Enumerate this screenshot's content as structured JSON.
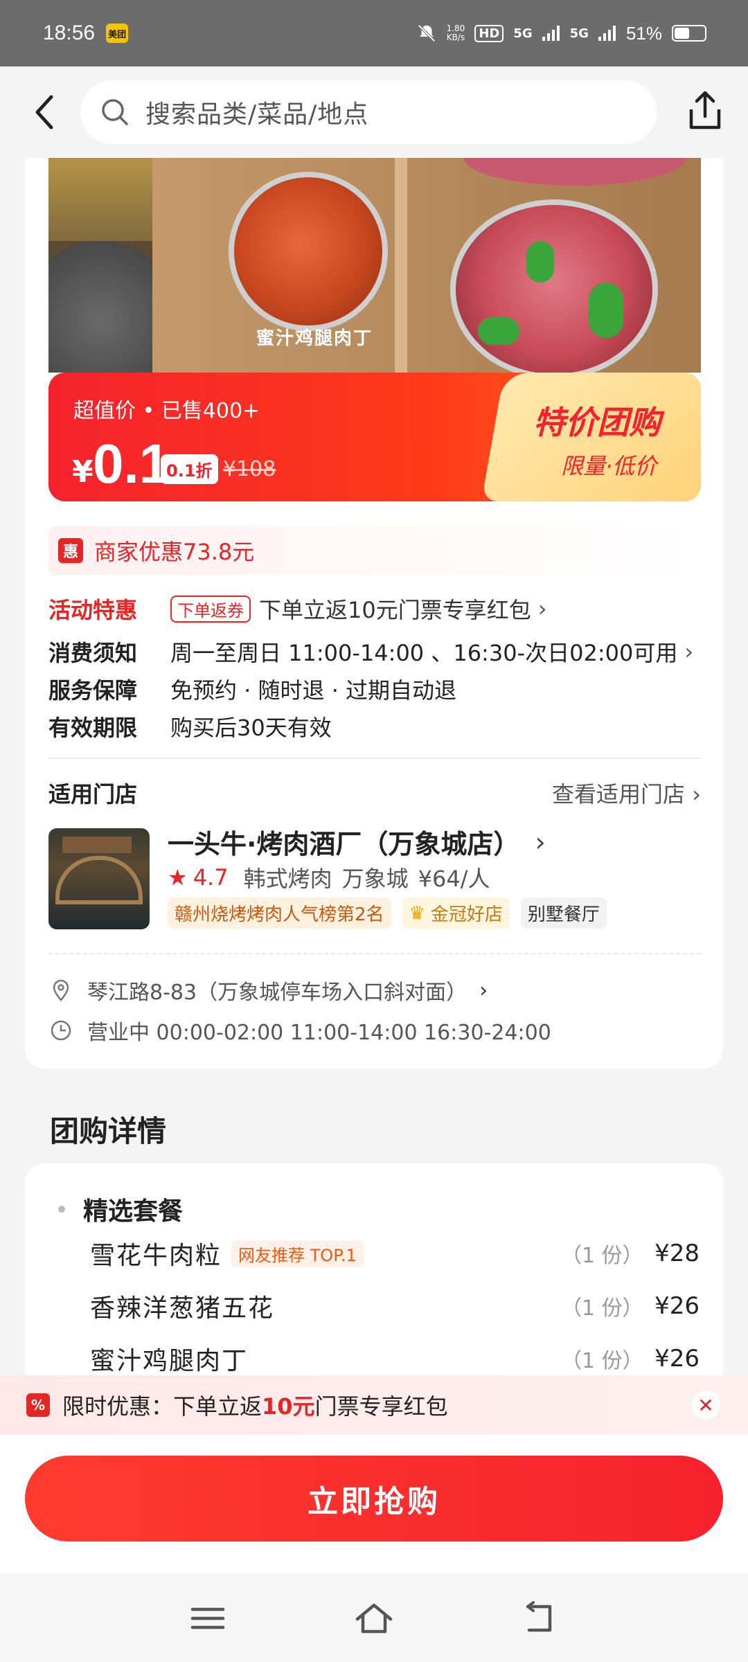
{
  "status_bar": {
    "time": "18:56",
    "app_badge": "美团",
    "speed_value": "1.80",
    "speed_unit": "KB/s",
    "hd": "HD",
    "net1": "5G",
    "net2": "5G",
    "battery_pct": "51%",
    "battery_level": 0.51
  },
  "header": {
    "search_placeholder": "搜索品类/菜品/地点"
  },
  "hero": {
    "image_label": "蜜汁鸡腿肉丁"
  },
  "price": {
    "tagline": "超值价 • 已售400+",
    "currency": "¥",
    "value": "0.1",
    "discount": "0.1折",
    "original": "¥108",
    "promo_title": "特价团购",
    "promo_sub": "限量·低价"
  },
  "merchant_discount": {
    "icon_text": "惠",
    "text": "商家优惠73.8元"
  },
  "info": {
    "activity_key": "活动特惠",
    "activity_tag": "下单返券",
    "activity_val": "下单立返10元门票专享红包",
    "notice_key": "消费须知",
    "notice_val": "周一至周日 11:00-14:00 、16:30-次日02:00可用",
    "service_key": "服务保障",
    "service_val": "免预约 · 随时退 · 过期自动退",
    "validity_key": "有效期限",
    "validity_val": "购买后30天有效"
  },
  "shop": {
    "section_label": "适用门店",
    "view_link": "查看适用门店",
    "name": "一头牛·烤肉酒厂（万象城店）",
    "rating": "4.7",
    "cuisine": "韩式烤肉",
    "area": "万象城",
    "avg_price": "¥64/人",
    "badge_rank": "赣州烧烤烤肉人气榜第2名",
    "badge_crown": "金冠好店",
    "badge_type": "别墅餐厅",
    "address": "琴江路8-83（万象城停车场入口斜对面）",
    "hours": "营业中 00:00-02:00 11:00-14:00 16:30-24:00"
  },
  "detail": {
    "title": "团购详情",
    "package_title": "精选套餐",
    "dishes": [
      {
        "name": "雪花牛肉粒",
        "tag": "网友推荐 TOP.1",
        "qty": "（1 份）",
        "price": "¥28"
      },
      {
        "name": "香辣洋葱猪五花",
        "tag": "",
        "qty": "（1 份）",
        "price": "¥26"
      },
      {
        "name": "蜜汁鸡腿肉丁",
        "tag": "",
        "qty": "（1 份）",
        "price": "¥26"
      }
    ]
  },
  "promo_strip": {
    "prefix": "限时优惠：下单立返",
    "amount": "10元",
    "suffix": "门票专享红包"
  },
  "buy_button": {
    "label": "立即抢购"
  },
  "colors": {
    "accent": "#e32626",
    "button": "#f5222d",
    "promo_gold": "#ffd37a"
  },
  "icons": [
    "back-icon",
    "search-icon",
    "share-icon",
    "location-icon",
    "clock-icon",
    "close-icon",
    "menu-icon",
    "home-icon",
    "back-nav-icon"
  ]
}
